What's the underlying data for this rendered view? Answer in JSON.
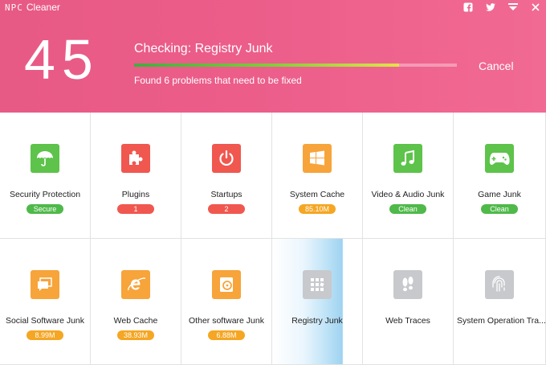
{
  "window": {
    "app_name": "Cleaner",
    "logo_mark": "NPC"
  },
  "header": {
    "count": "45",
    "status_title": "Checking: Registry Junk",
    "status_sub": "Found 6 problems that need to be fixed",
    "progress": 0.82,
    "cancel_label": "Cancel"
  },
  "colors": {
    "header": "#ec5d8a",
    "green": "#5dc34a",
    "red": "#f0574f",
    "orange": "#f7a43a",
    "gray": "#c7c9cc"
  },
  "tiles": [
    {
      "label": "Security Protection",
      "badge": "Secure",
      "icon": "umbrella-icon"
    },
    {
      "label": "Plugins",
      "badge": "1",
      "icon": "puzzle-icon"
    },
    {
      "label": "Startups",
      "badge": "2",
      "icon": "power-icon"
    },
    {
      "label": "System Cache",
      "badge": "85.10M",
      "icon": "windows-icon"
    },
    {
      "label": "Video & Audio Junk",
      "badge": "Clean",
      "icon": "music-note-icon"
    },
    {
      "label": "Game Junk",
      "badge": "Clean",
      "icon": "gamepad-icon"
    },
    {
      "label": "Social Software Junk",
      "badge": "8.99M",
      "icon": "chat-icon"
    },
    {
      "label": "Web Cache",
      "badge": "38.93M",
      "icon": "browser-e-icon"
    },
    {
      "label": "Other software Junk",
      "badge": "6.88M",
      "icon": "disc-icon"
    },
    {
      "label": "Registry Junk",
      "badge": "",
      "icon": "registry-grid-icon"
    },
    {
      "label": "Web Traces",
      "badge": "",
      "icon": "footprints-icon"
    },
    {
      "label": "System Operation Tra...",
      "badge": "",
      "icon": "fingerprint-icon"
    }
  ]
}
